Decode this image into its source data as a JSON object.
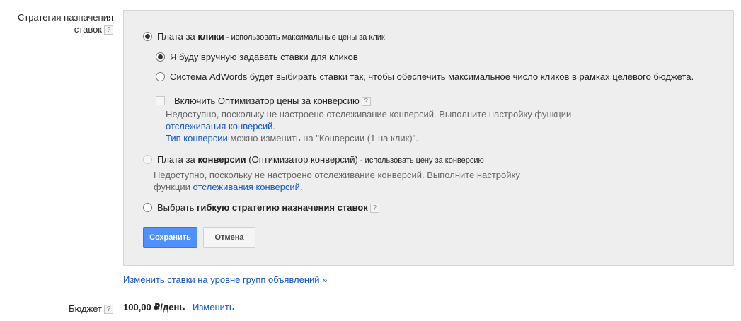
{
  "strategy": {
    "label_line1": "Стратегия назначения",
    "label_line2": "ставок",
    "help_glyph": "?"
  },
  "options": {
    "cpc": {
      "prefix": "Плата за ",
      "bold": "клики",
      "suffix": " - использовать максимальные цены за клик",
      "selected": true
    },
    "manual": {
      "label": "Я буду вручную задавать ставки для кликов",
      "selected": true
    },
    "auto": {
      "label": "Система AdWords будет выбирать ставки так, чтобы обеспечить максимальное число кликов в рамках целевого бюджета.",
      "selected": false
    },
    "ecpc": {
      "label": "Включить Оптимизатор цены за конверсию",
      "note_line1": "Недоступно, поскольку не настроено отслеживание конверсий. Выполните настройку функции",
      "note_link": "отслеживания конверсий",
      "note_period": ".",
      "type_link": "Тип конверсии",
      "type_text": " можно изменить на \"Конверсии (1 на клик)\"."
    },
    "cpa": {
      "prefix": "Плата за ",
      "bold": "конверсии",
      "middle": " (Оптимизатор конверсий)",
      "suffix": " - использовать цену за конверсию",
      "note_line1": "Недоступно, поскольку не настроено отслеживание конверсий. Выполните настройку",
      "note_line2_prefix": "функции ",
      "note_link": "отслеживания конверсий",
      "note_period": "."
    },
    "flexible": {
      "prefix": "Выбрать ",
      "bold": "гибкую стратегию назначения ставок"
    }
  },
  "buttons": {
    "save": "Сохранить",
    "cancel": "Отмена"
  },
  "change_bids_link": "Изменить ставки на уровне групп объявлений »",
  "budget": {
    "label": "Бюджет",
    "value": "100,00 ₽/день",
    "change": "Изменить"
  },
  "colors": {
    "panel_bg": "#eeeeee",
    "link": "#1155cc",
    "primary_button": "#4d90fe"
  }
}
